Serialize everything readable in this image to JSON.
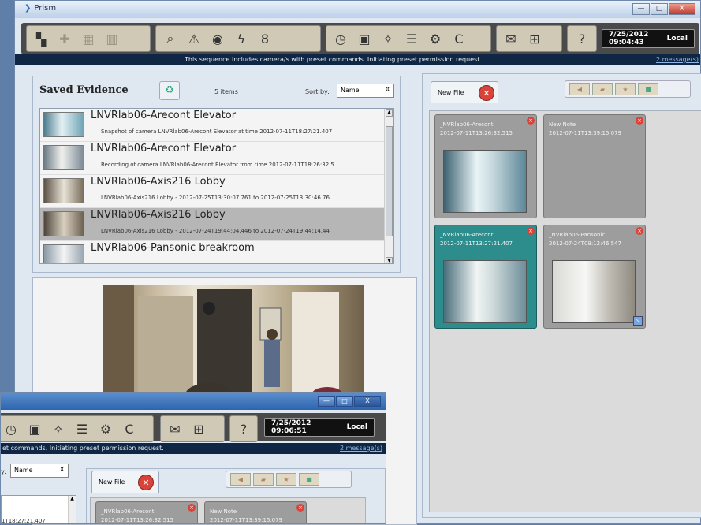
{
  "window": {
    "title": "Prism",
    "minimize": "—",
    "maximize": "□",
    "close": "X"
  },
  "toolbar": {
    "clock_time": "7/25/2012 09:04:43",
    "clock_zone": "Local",
    "icons": [
      "layout-icon",
      "grid-icon",
      "tile-icon",
      "wall-icon",
      "search-camera-icon",
      "alarm-search-icon",
      "globe-icon",
      "flash-icon",
      "lock-icon",
      "clock-icon",
      "monitor-icon",
      "wizard-icon",
      "list-settings-icon",
      "gear-list-icon",
      "tools-icon",
      "mail-icon",
      "network-icon",
      "help-icon"
    ]
  },
  "message_bar": {
    "text": "This sequence includes camera/s with preset commands. Initiating preset permission request.",
    "link": "2 message(s)"
  },
  "evidence": {
    "title": "Saved Evidence",
    "count": "5 items",
    "sort_label": "Sort by:",
    "sort_value": "Name",
    "items": [
      {
        "title": "LNVRlab06-Arecont Elevator",
        "subtitle": "Snapshot of camera LNVRlab06-Arecont Elevator at time 2012-07-11T18:27:21.407",
        "selected": false
      },
      {
        "title": "LNVRlab06-Arecont Elevator",
        "subtitle": "Recording of camera LNVRlab06-Arecont Elevator from time 2012-07-11T18:26:32.5",
        "selected": false
      },
      {
        "title": "LNVRlab06-Axis216 Lobby",
        "subtitle": "LNVRlab06-Axis216 Lobby - 2012-07-25T13:30:07.761 to 2012-07-25T13:30:46.76",
        "selected": false
      },
      {
        "title": "LNVRlab06-Axis216 Lobby",
        "subtitle": "LNVRlab06-Axis216 Lobby - 2012-07-24T19:44:04.446 to 2012-07-24T19:44:14.44",
        "selected": true
      },
      {
        "title": "LNVRlab06-Pansonic breakroom",
        "subtitle": "",
        "selected": false
      }
    ]
  },
  "files": {
    "tab_label": "New File",
    "cards": [
      {
        "name": "_NVRlab06-Arecont",
        "time": "2012-07-11T13:26:32.515",
        "style": "gray",
        "image": true
      },
      {
        "name": "New Note",
        "time": "2012-07-11T13:39:15.079",
        "style": "gray",
        "image": false
      },
      {
        "name": "_NVRlab06-Arecont",
        "time": "2012-07-11T13:27:21.407",
        "style": "teal",
        "image": true
      },
      {
        "name": "_NVRlab06-Pansonic",
        "time": "2012-07-24T09:12:46.547",
        "style": "gray",
        "image": true
      }
    ]
  },
  "window2": {
    "clock_time": "7/25/2012 09:06:51",
    "clock_zone": "Local",
    "message_text": "et commands.  Initiating preset permission request.",
    "message_link": "2 message(s)",
    "sort_label": "y:",
    "sort_value": "Name",
    "tab_label": "New File",
    "card1_name": "_NVRlab06-Arecont",
    "card1_time": "2012-07-11T13:26:32.515",
    "card2_name": "New Note",
    "card2_time": "2012-07-11T13:39:15.079",
    "list_fragment": "1T18:27:21.407"
  }
}
